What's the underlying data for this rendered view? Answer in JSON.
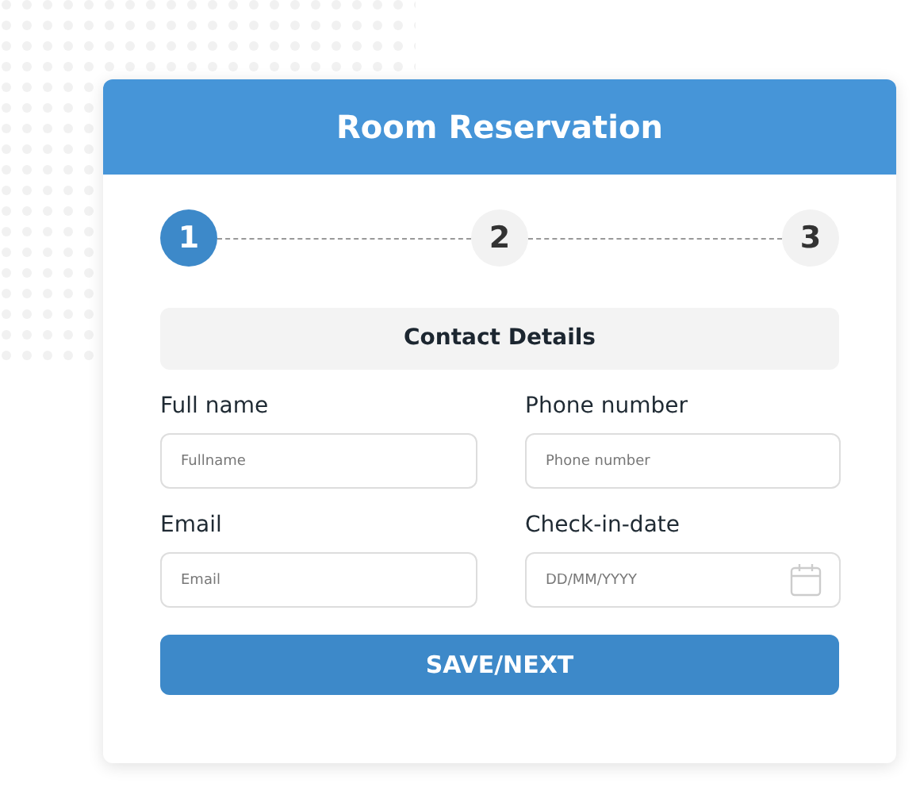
{
  "header": {
    "title": "Room Reservation"
  },
  "steps": [
    {
      "label": "1",
      "selected": true
    },
    {
      "label": "2",
      "selected": false
    },
    {
      "label": "3",
      "selected": false
    }
  ],
  "section": {
    "title": "Contact Details"
  },
  "fields": [
    {
      "label": "Full name",
      "placeholder": "Fullname",
      "kind": "text"
    },
    {
      "label": "Phone number",
      "placeholder": "Phone number",
      "kind": "text"
    },
    {
      "label": "Email",
      "placeholder": "Email",
      "kind": "text"
    },
    {
      "label": "Check-in-date",
      "placeholder": "DD/MM/YYYY",
      "kind": "date"
    }
  ],
  "button": {
    "label": "SAVE/NEXT"
  }
}
